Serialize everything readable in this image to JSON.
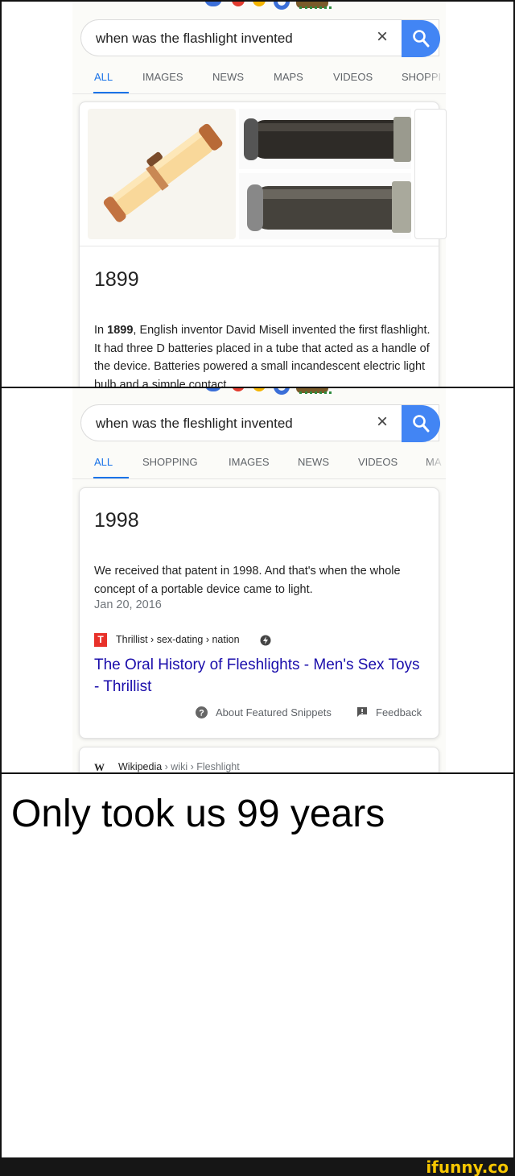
{
  "panel1": {
    "query": "when was the flashlight invented",
    "clear_glyph": "×",
    "tabs": [
      "ALL",
      "IMAGES",
      "NEWS",
      "MAPS",
      "VIDEOS",
      "SHOPPI"
    ],
    "active_tab": "ALL",
    "answer_year": "1899",
    "snippet_pre": "In ",
    "snippet_bold": "1899",
    "snippet_post": ", English inventor David Misell invented the first flashlight. It had three D batteries placed in a tube that acted as a handle of the device. Batteries powered a small incandescent electric light bulb and a simple contact",
    "images": [
      "flashlight-tube-photo",
      "dark-flashlight-photo",
      "gray-flashlight-photo"
    ]
  },
  "panel2": {
    "query": "when was the fleshlight invented",
    "clear_glyph": "×",
    "tabs": [
      "ALL",
      "SHOPPING",
      "IMAGES",
      "NEWS",
      "VIDEOS",
      "MA"
    ],
    "active_tab": "ALL",
    "answer_year": "1998",
    "snippet": "We received that patent in 1998. And that's when the whole concept of a portable device came to light.",
    "date": "Jan 20, 2016",
    "source_icon_letter": "T",
    "source_breadcrumb": "Thrillist › sex-dating › nation",
    "result_title": "The Oral History of Fleshlights - Men's Sex Toys - Thrillist",
    "about_label": "About Featured Snippets",
    "feedback_label": "Feedback",
    "next_result_site": "Wikipedia",
    "next_result_path": " › wiki › Fleshlight",
    "next_result_icon": "W"
  },
  "caption": "Only took us 99 years",
  "watermark": "ifunny.co",
  "colors": {
    "google_blue": "#4285f4",
    "tab_active": "#1a73e8",
    "link_blue": "#1a0dab",
    "thrillist_red": "#e8312a",
    "watermark_yellow": "#f7c600"
  }
}
